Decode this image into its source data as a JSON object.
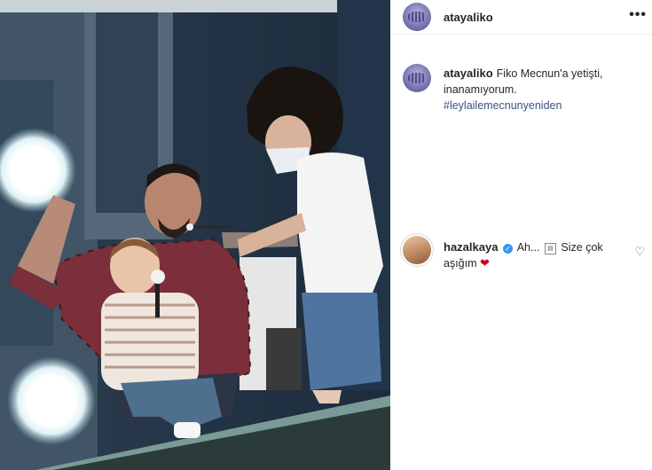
{
  "post": {
    "username": "atayaliko",
    "more_label": "•••"
  },
  "caption": {
    "username": "atayaliko",
    "text": "Fiko Mecnun'a yetişti, inanamıyorum.",
    "hashtag": "#leylailemecnunyeniden"
  },
  "comment": {
    "username": "hazalkaya",
    "verified_icon": "verified-badge-icon",
    "text_before": "Ah...",
    "emoji_icon": "open-book-emoji-icon",
    "text_after": "Size çok aşığım",
    "heart": "❤"
  },
  "colors": {
    "hashtag": "#385185",
    "verified": "#3897f0",
    "heart": "#d0021b"
  }
}
